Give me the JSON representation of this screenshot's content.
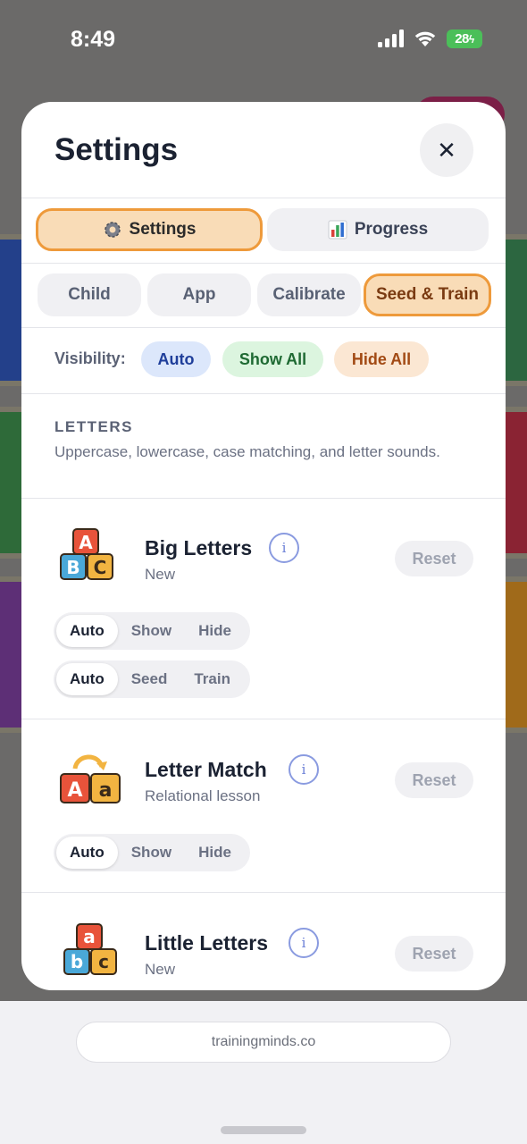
{
  "status_bar": {
    "time": "8:49",
    "battery": "28"
  },
  "sheet": {
    "title": "Settings",
    "close_label": "✕",
    "main_tabs": [
      {
        "label": "Settings",
        "icon": "gear-icon"
      },
      {
        "label": "Progress",
        "icon": "bar-chart-icon"
      }
    ],
    "sub_tabs": [
      "Child",
      "App",
      "Calibrate",
      "Seed & Train"
    ],
    "active_sub_tab": "Seed & Train",
    "visibility": {
      "label": "Visibility:",
      "options": [
        "Auto",
        "Show All",
        "Hide All"
      ]
    },
    "section": {
      "title": "LETTERS",
      "description": "Uppercase, lowercase, case matching, and letter sounds."
    },
    "items": [
      {
        "name": "Big Letters",
        "subtitle": "New",
        "reset": "Reset",
        "info": "i",
        "icon": "abc-blocks-icon",
        "visibility_options": [
          "Auto",
          "Show",
          "Hide"
        ],
        "visibility_selected": "Auto",
        "mode_options": [
          "Auto",
          "Seed",
          "Train"
        ],
        "mode_selected": "Auto"
      },
      {
        "name": "Letter Match",
        "subtitle": "Relational lesson",
        "reset": "Reset",
        "info": "i",
        "icon": "letter-match-blocks-icon",
        "visibility_options": [
          "Auto",
          "Show",
          "Hide"
        ],
        "visibility_selected": "Auto"
      },
      {
        "name": "Little Letters",
        "subtitle": "New",
        "reset": "Reset",
        "info": "i",
        "icon": "lowercase-blocks-icon"
      }
    ]
  },
  "browser": {
    "url": "trainingminds.co"
  },
  "colors": {
    "accent": "#ee9a3b",
    "accent_fill": "#f9dcb7"
  }
}
